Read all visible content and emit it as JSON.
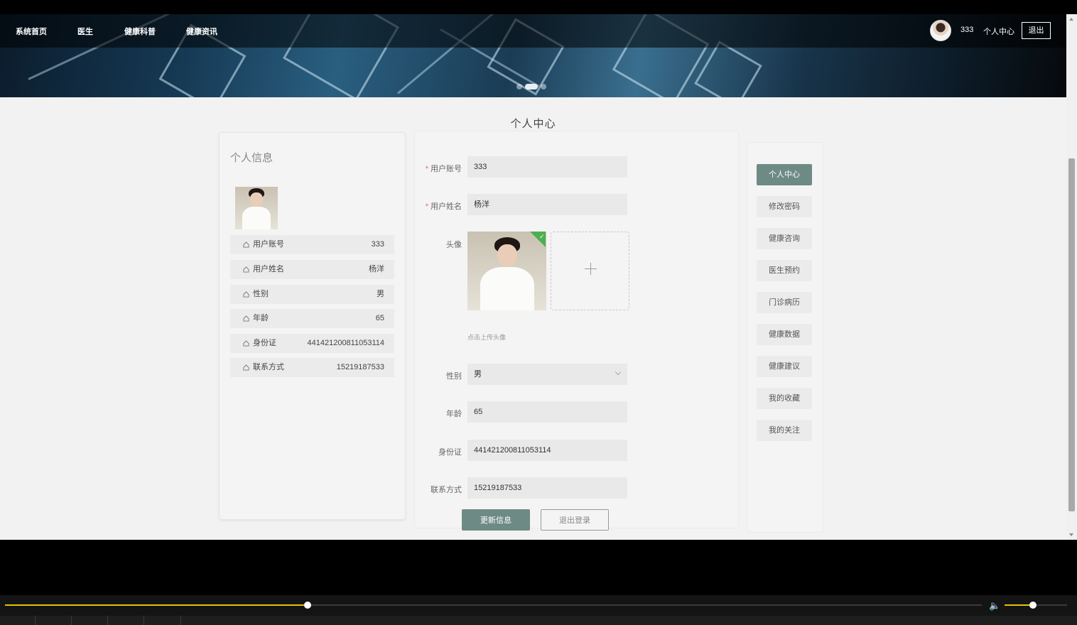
{
  "nav": {
    "items": [
      "系统首页",
      "医生",
      "健康科普",
      "健康资讯"
    ],
    "username": "333",
    "personal_center": "个人中心",
    "logout": "退出"
  },
  "page_title": "个人中心",
  "profile_card": {
    "title": "个人信息",
    "rows": [
      {
        "label": "用户账号",
        "value": "333"
      },
      {
        "label": "用户姓名",
        "value": "杨洋"
      },
      {
        "label": "性别",
        "value": "男"
      },
      {
        "label": "年龄",
        "value": "65"
      },
      {
        "label": "身份证",
        "value": "441421200811053114"
      },
      {
        "label": "联系方式",
        "value": "15219187533"
      }
    ]
  },
  "form": {
    "account_label": "用户账号",
    "account_value": "333",
    "name_label": "用户姓名",
    "name_value": "杨洋",
    "avatar_label": "头像",
    "upload_tip": "点击上传头像",
    "gender_label": "性别",
    "gender_value": "男",
    "age_label": "年龄",
    "age_value": "65",
    "idcard_label": "身份证",
    "idcard_value": "441421200811053114",
    "phone_label": "联系方式",
    "phone_value": "15219187533",
    "update_button": "更新信息",
    "logout_button": "退出登录"
  },
  "side_menu": {
    "items": [
      "个人中心",
      "修改密码",
      "健康咨询",
      "医生预约",
      "门诊病历",
      "健康数据",
      "健康建议",
      "我的收藏",
      "我的关注"
    ],
    "active_index": 0
  },
  "player": {
    "progress_fraction": 0.31,
    "volume_fraction": 0.45
  },
  "colors": {
    "accent": "#6e8a85",
    "seek": "#e6c200",
    "success": "#4caf50"
  }
}
